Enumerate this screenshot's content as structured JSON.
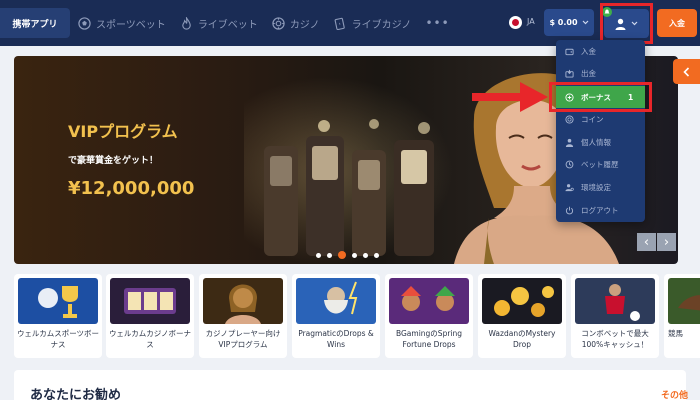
{
  "header": {
    "app_button": "携帯アプリ",
    "nav": [
      {
        "label": "スポーツベット",
        "icon": "soccer-ball-icon"
      },
      {
        "label": "ライブベット",
        "icon": "fire-icon"
      },
      {
        "label": "カジノ",
        "icon": "casino-chip-icon"
      },
      {
        "label": "ライブカジノ",
        "icon": "card-icon"
      }
    ],
    "more": "•••",
    "language": "JA",
    "balance": "$ 0.00",
    "deposit_button": "入金"
  },
  "hero": {
    "title": "VIPプログラム",
    "subtitle": "で豪華賞金をゲット！",
    "amount": "¥12,000,000",
    "slide_count": 6,
    "active_slide": 3,
    "prev_arrow": "‹",
    "next_arrow": "›"
  },
  "user_menu": {
    "items": [
      {
        "label": "入金",
        "icon": "wallet-icon"
      },
      {
        "label": "出金",
        "icon": "withdraw-icon"
      },
      {
        "label": "ボーナス",
        "icon": "gift-icon",
        "count": "1",
        "active": true
      },
      {
        "label": "コイン",
        "icon": "coin-icon"
      },
      {
        "label": "個人情報",
        "icon": "user-icon"
      },
      {
        "label": "ベット履歴",
        "icon": "history-icon"
      },
      {
        "label": "環境設定",
        "icon": "settings-icon"
      },
      {
        "label": "ログアウト",
        "icon": "logout-icon"
      }
    ]
  },
  "promos": [
    {
      "label": "ウェルカムスポーツボーナス"
    },
    {
      "label": "ウェルカムカジノボーナス"
    },
    {
      "label": "カジノプレーヤー向け VIPプログラム"
    },
    {
      "label": "PragmaticのDrops & Wins"
    },
    {
      "label": "BGamingのSpring Fortune Drops"
    },
    {
      "label": "WazdanのMystery Drop"
    },
    {
      "label": "コンボベットで最大100%キャッシュ！"
    },
    {
      "label": "競馬"
    }
  ],
  "recommendations": {
    "title": "あなたにお勧め",
    "more_link": "その他"
  },
  "colors": {
    "header_bg": "#1a2c55",
    "accent_orange": "#f26b21",
    "menu_bg": "#1e3a72",
    "active_green": "#3fa64a",
    "highlight_red": "#e8262a",
    "gold": "#f2c14e"
  }
}
